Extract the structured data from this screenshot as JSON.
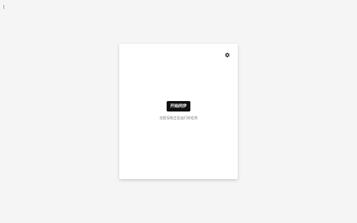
{
  "main": {
    "sync_button_label": "开始同步",
    "status_text": "当前没有正在运行的任务",
    "settings_icon": "gear-icon"
  },
  "colors": {
    "background": "#f5f5f5",
    "card": "#ffffff",
    "button": "#111111",
    "button_text": "#ffffff",
    "status_text": "#777777"
  }
}
